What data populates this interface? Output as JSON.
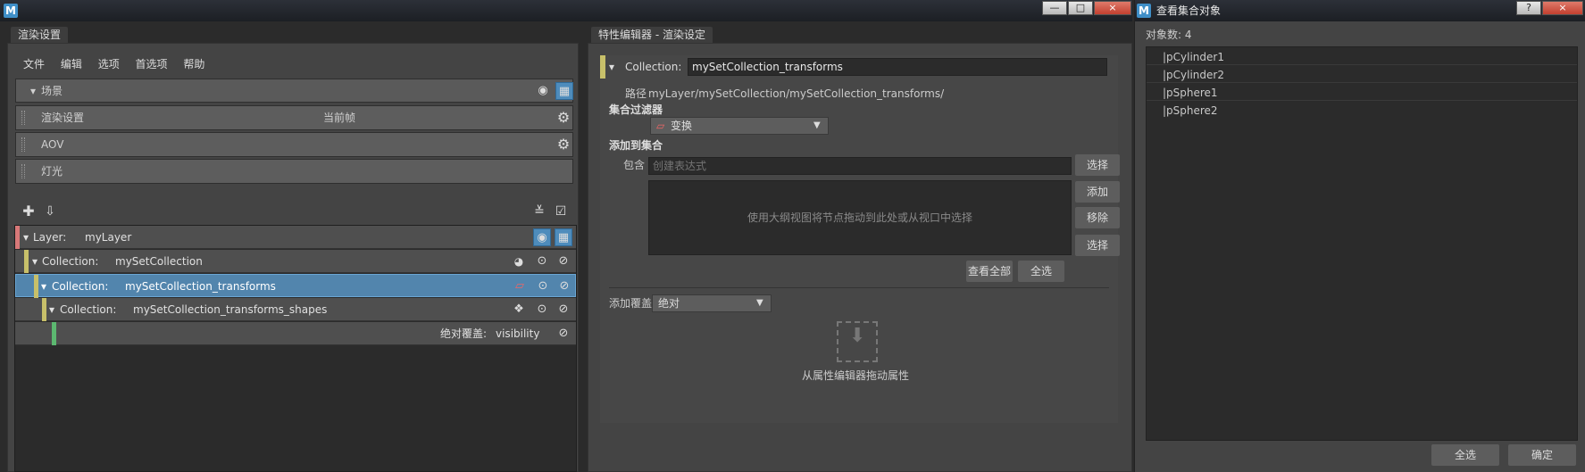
{
  "render_window": {
    "tab": "渲染设置",
    "menu": [
      "文件",
      "编辑",
      "选项",
      "首选项",
      "帮助"
    ],
    "scene_header": "场景",
    "scene_rows": [
      {
        "label": "渲染设置",
        "value": "当前帧"
      },
      {
        "label": "AOV",
        "value": ""
      },
      {
        "label": "灯光",
        "value": ""
      }
    ],
    "tree": [
      {
        "prefix": "Layer:",
        "name": "myLayer"
      },
      {
        "prefix": "Collection:",
        "name": "mySetCollection"
      },
      {
        "prefix": "Collection:",
        "name": "mySetCollection_transforms"
      },
      {
        "prefix": "Collection:",
        "name": "mySetCollection_transforms_shapes"
      }
    ],
    "override": {
      "label": "绝对覆盖:",
      "name": "visibility"
    }
  },
  "attr_editor": {
    "tab": "特性编辑器 - 渲染设定",
    "collection_label": "Collection:",
    "collection_name": "mySetCollection_transforms",
    "path_label": "路径",
    "path_value": "myLayer/mySetCollection/mySetCollection_transforms/",
    "filter_label": "集合过滤器",
    "filter_value": "变换",
    "add_to_collection": "添加到集合",
    "include_label": "包含",
    "include_placeholder": "创建表达式",
    "select_btn": "选择",
    "drop_hint": "使用大纲视图将节点拖动到此处或从视口中选择",
    "add_btn": "添加",
    "remove_btn": "移除",
    "select_btn2": "选择",
    "view_all_btn": "查看全部",
    "select_all_btn": "全选",
    "add_override_label": "添加覆盖",
    "add_override_value": "绝对",
    "drag_attr_hint": "从属性编辑器拖动属性"
  },
  "view_window": {
    "title": "查看集合对象",
    "count_label": "对象数: 4",
    "items": [
      "|pCylinder1",
      "|pCylinder2",
      "|pSphere1",
      "|pSphere2"
    ],
    "select_all_btn": "全选",
    "ok_btn": "确定",
    "help_btn": "?",
    "close_btn": "×"
  },
  "main_window": {
    "minimize": "—",
    "maximize": "□",
    "close": "×"
  },
  "colors": {
    "layer_bar": "#d87878",
    "collection_bar": "#c8c06a",
    "override_bar": "#5cb870",
    "selected_row": "#5285ad"
  }
}
